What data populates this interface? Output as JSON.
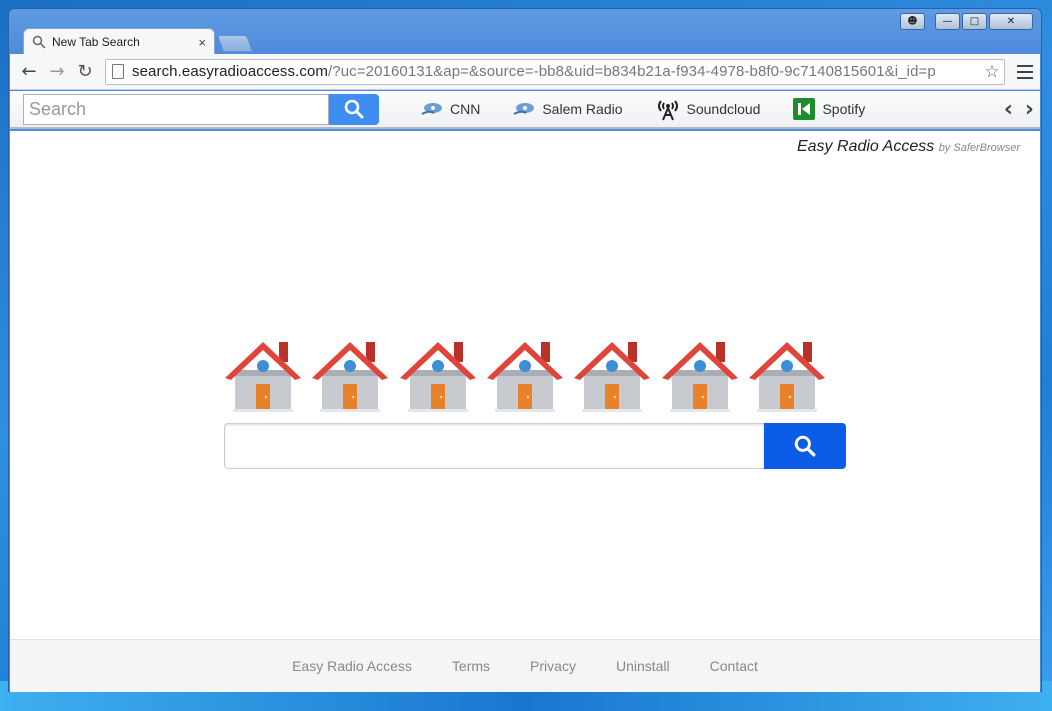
{
  "window": {
    "controls": [
      "user",
      "minimize",
      "maximize",
      "close"
    ]
  },
  "tab": {
    "title": "New Tab Search",
    "icon": "search-icon",
    "close": "×"
  },
  "toolbar": {
    "url_host": "search.easyradioaccess.com",
    "url_rest": "/?uc=20160131&ap=&source=-bb8&uid=b834b21a-f934-4978-b8f0-9c7140815601&i_id=p",
    "back": "←",
    "forward": "→",
    "reload": "↻",
    "star": "☆"
  },
  "ext_bar": {
    "search_placeholder": "Search",
    "links": [
      {
        "label": "CNN",
        "icon": "radio-wave-icon"
      },
      {
        "label": "Salem Radio",
        "icon": "radio-wave-icon"
      },
      {
        "label": "Soundcloud",
        "icon": "antenna-icon"
      },
      {
        "label": "Spotify",
        "icon": "spotify-icon"
      }
    ],
    "prev": "‹",
    "next": "›"
  },
  "brand": {
    "name": "Easy Radio Access",
    "by": "by SaferBrowser"
  },
  "houses_count": 7,
  "footer": {
    "links": [
      "Easy Radio Access",
      "Terms",
      "Privacy",
      "Uninstall",
      "Contact"
    ]
  },
  "colors": {
    "ext_search_button": "#3d8ef0",
    "main_search_button": "#0b5ce6",
    "house_roof": "#e0443a",
    "house_wall": "#c7cbd0",
    "house_door": "#e8822a",
    "house_window": "#3a8fd6"
  }
}
